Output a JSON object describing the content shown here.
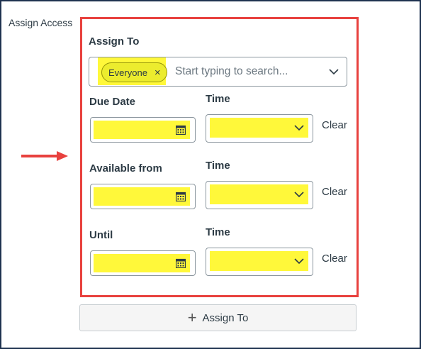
{
  "side_label": "Assign Access",
  "assign_to": {
    "title": "Assign To",
    "token": "Everyone",
    "token_remove": "×",
    "placeholder": "Start typing to search..."
  },
  "rows": [
    {
      "label": "Due Date",
      "time_label": "Time",
      "clear": "Clear"
    },
    {
      "label": "Available from",
      "time_label": "Time",
      "clear": "Clear"
    },
    {
      "label": "Until",
      "time_label": "Time",
      "clear": "Clear"
    }
  ],
  "add_button": {
    "icon": "+",
    "label": "Assign To"
  },
  "colors": {
    "highlight": "#fff83a",
    "callout_border": "#e8413e",
    "arrow": "#e8413e",
    "frame": "#1f3250"
  }
}
